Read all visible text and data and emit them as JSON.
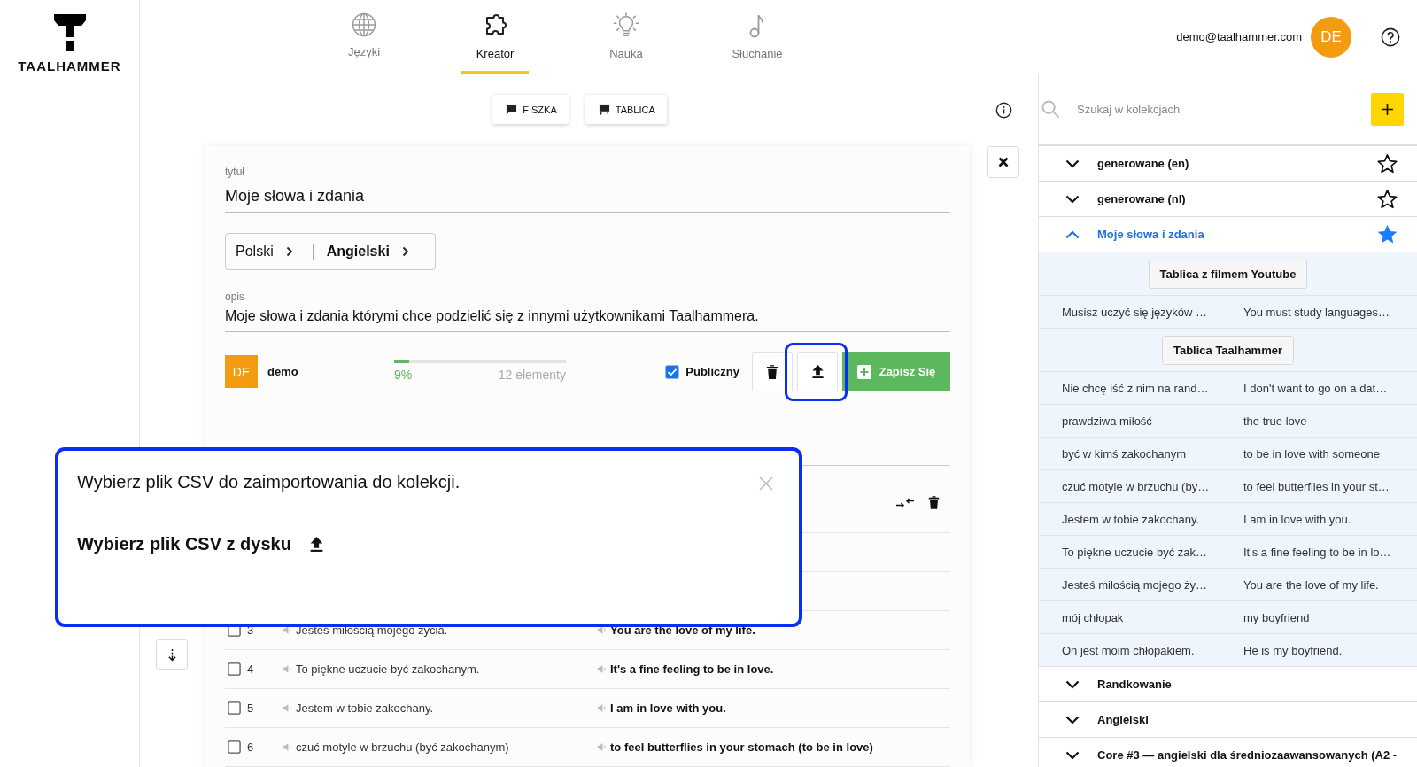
{
  "logo": {
    "text": "TAALHAMMER"
  },
  "nav": {
    "tabs": [
      {
        "label": "Języki",
        "selected": false
      },
      {
        "label": "Kreator",
        "selected": true
      },
      {
        "label": "Nauka",
        "selected": false
      },
      {
        "label": "Słuchanie",
        "selected": false
      }
    ]
  },
  "user": {
    "email": "demo@taalhammer.com",
    "initials": "DE"
  },
  "toolbar": {
    "buttons": [
      "FISZKA",
      "TABLICA"
    ]
  },
  "editor": {
    "title_label": "tytuł",
    "title_value": "Moje słowa i zdania",
    "source_language": "Polski",
    "target_language": "Angielski",
    "description_label": "opis",
    "description_value": "Moje słowa i zdania którymi chce podzielić się z innymi użytkownikami Taalhammera.",
    "author": {
      "initials": "DE",
      "name": "demo"
    },
    "progress": {
      "level": 0.09,
      "percent": "9%",
      "count": "12 elementy"
    },
    "public": {
      "label": "Publiczny",
      "checked": true
    },
    "upload_highlighted": true,
    "subscribe_button": "Zapisz Się"
  },
  "rows": [
    {
      "number": "3",
      "source": "Jesteś miłością mojego życia.",
      "target": "You are the love of my life.",
      "checked": false
    },
    {
      "number": "4",
      "source": "To piękne uczucie być zakochanym.",
      "target": "It's a fine feeling to be in love.",
      "checked": false
    },
    {
      "number": "5",
      "source": "Jestem w tobie zakochany.",
      "target": "I am in love with you.",
      "checked": false
    },
    {
      "number": "6",
      "source": "czuć motyle w brzuchu (być zakochanym)",
      "target": "to feel butterflies in your stomach (to be in love)",
      "checked": false
    }
  ],
  "import_dialog": {
    "message": "Wybierz plik CSV do zaimportowania do kolekcji.",
    "pick_label": "Wybierz plik CSV z dysku"
  },
  "sidebar": {
    "search": {
      "placeholder": "Szukaj w kolekcjach"
    },
    "collections": [
      {
        "title": "generowane (en)",
        "expanded": false,
        "starred": false
      },
      {
        "title": "generowane (nl)",
        "expanded": false,
        "starred": false
      },
      {
        "title": "Moje słowa i zdania",
        "expanded": true,
        "starred": true,
        "groups": [
          {
            "board": "Tablica z filmem Youtube",
            "pairs": [
              {
                "source": "Musisz uczyć się języków …",
                "target": "You must study languages…"
              }
            ]
          },
          {
            "board": "Tablica Taalhammer",
            "pairs": [
              {
                "source": "Nie chcę iść z nim na rand…",
                "target": "I don't want to go on a dat…"
              },
              {
                "source": "prawdziwa miłość",
                "target": "the true love"
              },
              {
                "source": "być w kimś zakochanym",
                "target": "to be in love with someone"
              },
              {
                "source": "czuć motyle w brzuchu (by…",
                "target": "to feel butterflies in your st…"
              },
              {
                "source": "Jestem w tobie zakochany.",
                "target": "I am in love with you."
              },
              {
                "source": "To piękne uczucie być zak…",
                "target": "It's a fine feeling to be in lo…"
              },
              {
                "source": "Jesteś miłością mojego ży…",
                "target": "You are the love of my life."
              },
              {
                "source": "mój chłopak",
                "target": "my boyfriend"
              },
              {
                "source": "On jest moim chłopakiem.",
                "target": "He is my boyfriend."
              }
            ]
          }
        ]
      },
      {
        "title": "Randkowanie",
        "expanded": false
      },
      {
        "title": "Angielski",
        "expanded": false
      },
      {
        "title": "Core #3 — angielski dla średniozaawansowanych (A2 -",
        "expanded": false
      }
    ]
  }
}
